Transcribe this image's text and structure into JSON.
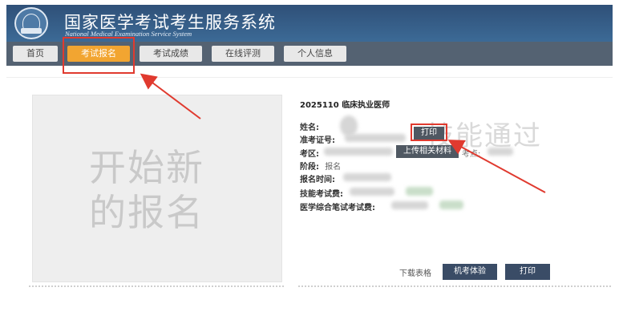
{
  "header": {
    "title_cn": "国家医学考试考生服务系统",
    "title_en": "National Medical Examination Service System"
  },
  "nav": {
    "tabs": [
      {
        "label": "首页",
        "active": false
      },
      {
        "label": "考试报名",
        "active": true
      },
      {
        "label": "考试成绩",
        "active": false
      },
      {
        "label": "在线评测",
        "active": false
      },
      {
        "label": "个人信息",
        "active": false
      }
    ]
  },
  "left_panel": {
    "line1": "开始新",
    "line2": "的报名"
  },
  "exam": {
    "title": "2025110 临床执业医师",
    "watermark": "技能通过",
    "fields": {
      "name_label": "姓名:",
      "ticket_label": "准考证号:",
      "area_label": "考区:",
      "stage_label": "阶段:",
      "stage_value": "报名",
      "time_label": "报名时间:",
      "skill_fee_label": "技能考试费:",
      "written_fee_label": "医学综合笔试考试费:"
    },
    "print_small": "打印",
    "upload_btn": "上传相关材料",
    "area_extra": "考点:"
  },
  "footer_actions": {
    "download_link": "下载表格",
    "machine_btn": "机考体验",
    "print_btn": "打印"
  },
  "colors": {
    "header": "#2f5078",
    "nav": "#546272",
    "active_tab": "#f2a531",
    "annotation": "#e03a2f"
  }
}
